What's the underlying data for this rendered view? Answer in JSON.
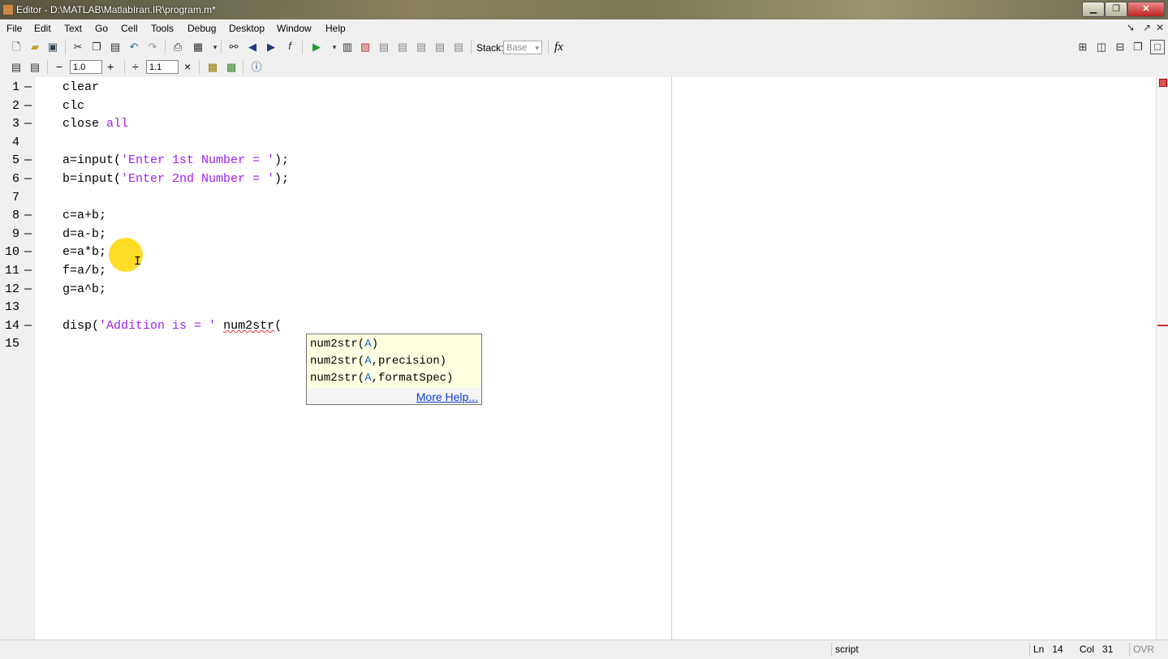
{
  "window": {
    "title": "Editor - D:\\MATLAB\\MatlabIran.IR\\program.m*",
    "minimize": "▁",
    "maximize": "❐",
    "close": "✕"
  },
  "menu": {
    "items": [
      "File",
      "Edit",
      "Text",
      "Go",
      "Cell",
      "Tools",
      "Debug",
      "Desktop",
      "Window",
      "Help"
    ],
    "undock": "➘",
    "pin": "↗",
    "close": "✕"
  },
  "toolbar": {
    "stack_label": "Stack:",
    "stack_value": "Base",
    "fx_label": "fx"
  },
  "cell_toolbar": {
    "minus": "−",
    "value1": "1.0",
    "plus": "+",
    "divide": "÷",
    "value2": "1.1",
    "times": "×"
  },
  "editor": {
    "line_numbers": [
      "1",
      "2",
      "3",
      "4",
      "5",
      "6",
      "7",
      "8",
      "9",
      "10",
      "11",
      "12",
      "13",
      "14",
      "15"
    ],
    "breakpoint_dashes": [
      "—",
      "—",
      "—",
      "",
      "—",
      "—",
      "",
      "—",
      "—",
      "—",
      "—",
      "—",
      "",
      "—",
      ""
    ],
    "code": {
      "l1": "clear",
      "l2": "clc",
      "l3_kw": "close ",
      "l3_arg": "all",
      "l5_a": "a=input(",
      "l5_s": "'Enter 1st Number = '",
      "l5_b": ");",
      "l6_a": "b=input(",
      "l6_s": "'Enter 2nd Number = '",
      "l6_b": ");",
      "l8": "c=a+b;",
      "l9": "d=a-b;",
      "l10": "e=a*b;",
      "l11": "f=a/b;",
      "l12": "g=a^b;",
      "l14_a": "disp(",
      "l14_s": "'Addition is = '",
      "l14_sp": " ",
      "l14_fn": "num2str",
      "l14_b": "("
    }
  },
  "popup": {
    "sig1_fn": "num2str(",
    "sig1_arg": "A",
    "sig1_end": ")",
    "sig2_fn": "num2str(",
    "sig2_arg": "A",
    "sig2_end": ",precision)",
    "sig3_fn": "num2str(",
    "sig3_arg": "A",
    "sig3_end": ",formatSpec)",
    "more_help": "More Help..."
  },
  "status": {
    "mode": "script",
    "ln_label": "Ln",
    "ln_value": "14",
    "col_label": "Col",
    "col_value": "31",
    "ovr": "OVR"
  }
}
